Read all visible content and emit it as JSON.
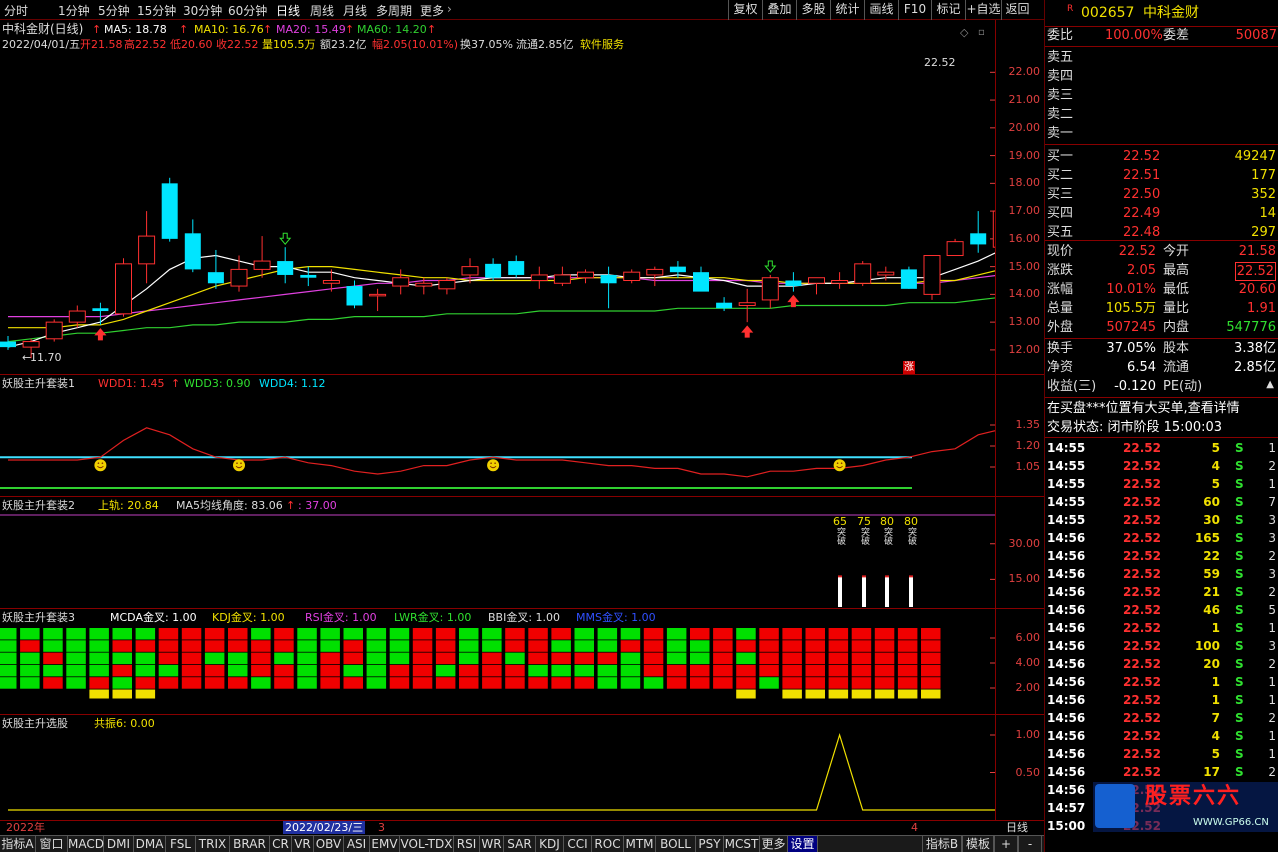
{
  "toolbar": {
    "periods": [
      "分时",
      "1分钟",
      "5分钟",
      "15分钟",
      "30分钟",
      "60分钟",
      "日线",
      "周线",
      "月线",
      "多周期",
      "更多"
    ],
    "active_period": "日线",
    "right_buttons": [
      "复权",
      "叠加",
      "多股",
      "统计",
      "画线",
      "F10",
      "标记",
      "+自选",
      "返回"
    ]
  },
  "main_panel": {
    "title": "中科金财(日线)",
    "ma5": "MA5: 18.78",
    "ma10": "MA10: 16.76",
    "ma20": "MA20: 15.49",
    "ma60": "MA60: 14.20",
    "bar_info": {
      "date": "2022/04/01/五",
      "open": "开21.58",
      "high": "高22.52",
      "low": "低20.60",
      "close": "收22.52",
      "vol": "量105.5万",
      "amount": "额23.2亿",
      "change": "幅2.05(10.01%)",
      "turnover": "换37.05%",
      "float": "流通2.85亿",
      "sector": "软件服务"
    },
    "y_ticks": [
      "22.00",
      "21.00",
      "20.00",
      "19.00",
      "18.00",
      "17.00",
      "16.00",
      "15.00",
      "14.00",
      "13.00",
      "12.00"
    ],
    "high_label": "22.52",
    "low_label": "11.70",
    "zhang_mark": "涨"
  },
  "chart_data": {
    "type": "candlestick",
    "ylim": [
      11.6,
      23.2
    ],
    "ohlc": [
      [
        12.3,
        12.5,
        12.0,
        12.1
      ],
      [
        12.1,
        12.4,
        11.7,
        12.3
      ],
      [
        12.4,
        13.1,
        12.3,
        13.0
      ],
      [
        13.0,
        13.6,
        12.8,
        13.4
      ],
      [
        13.5,
        13.7,
        12.9,
        13.4
      ],
      [
        13.3,
        15.3,
        13.2,
        15.1
      ],
      [
        15.1,
        17.0,
        14.4,
        16.1
      ],
      [
        18.0,
        18.2,
        15.9,
        16.0
      ],
      [
        16.2,
        16.7,
        14.8,
        14.9
      ],
      [
        14.8,
        15.6,
        14.2,
        14.4
      ],
      [
        14.3,
        15.4,
        14.1,
        14.9
      ],
      [
        14.9,
        16.1,
        14.6,
        15.2
      ],
      [
        15.2,
        15.7,
        14.4,
        14.7
      ],
      [
        14.7,
        15.0,
        14.3,
        14.6
      ],
      [
        14.4,
        14.9,
        14.1,
        14.5
      ],
      [
        14.3,
        14.5,
        13.5,
        13.6
      ],
      [
        14.0,
        14.2,
        13.4,
        14.0
      ],
      [
        14.3,
        14.9,
        14.0,
        14.6
      ],
      [
        14.3,
        14.6,
        14.0,
        14.4
      ],
      [
        14.2,
        14.6,
        14.0,
        14.5
      ],
      [
        14.7,
        15.3,
        14.4,
        15.0
      ],
      [
        15.1,
        15.3,
        14.5,
        14.6
      ],
      [
        15.2,
        15.4,
        14.6,
        14.7
      ],
      [
        14.5,
        15.0,
        14.2,
        14.7
      ],
      [
        14.4,
        15.0,
        14.3,
        14.7
      ],
      [
        14.6,
        14.9,
        14.4,
        14.8
      ],
      [
        14.7,
        15.0,
        13.5,
        14.4
      ],
      [
        14.5,
        14.9,
        14.4,
        14.8
      ],
      [
        14.7,
        15.0,
        14.3,
        14.9
      ],
      [
        15.0,
        15.2,
        14.6,
        14.8
      ],
      [
        14.8,
        15.0,
        14.2,
        14.1
      ],
      [
        13.7,
        13.9,
        13.4,
        13.5
      ],
      [
        13.6,
        14.2,
        13.0,
        13.7
      ],
      [
        13.8,
        14.7,
        13.5,
        14.6
      ],
      [
        14.5,
        14.8,
        14.1,
        14.3
      ],
      [
        14.4,
        14.6,
        14.0,
        14.6
      ],
      [
        14.4,
        14.8,
        14.2,
        14.5
      ],
      [
        14.4,
        15.2,
        14.3,
        15.1
      ],
      [
        14.7,
        15.0,
        14.5,
        14.8
      ],
      [
        14.9,
        15.0,
        14.2,
        14.2
      ],
      [
        14.0,
        15.4,
        13.8,
        15.4
      ],
      [
        15.4,
        16.0,
        15.4,
        15.9
      ],
      [
        16.2,
        17.0,
        15.5,
        15.8
      ],
      [
        15.7,
        17.2,
        15.5,
        17.0
      ],
      [
        16.8,
        18.7,
        16.6,
        18.5
      ],
      [
        18.8,
        21.0,
        18.6,
        20.5
      ],
      [
        20.7,
        22.52,
        20.6,
        22.52
      ]
    ],
    "ma5": [
      12.1,
      12.3,
      12.6,
      12.8,
      13.0,
      13.6,
      14.2,
      14.9,
      15.3,
      15.4,
      15.2,
      15.0,
      15.0,
      14.8,
      14.8,
      14.6,
      14.5,
      14.4,
      14.3,
      14.4,
      14.5,
      14.6,
      14.6,
      14.6,
      14.7,
      14.7,
      14.7,
      14.6,
      14.6,
      14.7,
      14.6,
      14.5,
      14.3,
      14.3,
      14.3,
      14.4,
      14.4,
      14.5,
      14.6,
      14.6,
      14.6,
      14.9,
      15.2,
      15.6,
      16.3,
      17.5,
      18.8
    ],
    "ma10": [
      12.8,
      12.8,
      12.8,
      12.9,
      12.9,
      13.1,
      13.4,
      13.7,
      14.0,
      14.3,
      14.5,
      14.7,
      14.9,
      15.0,
      15.0,
      14.9,
      14.8,
      14.7,
      14.6,
      14.6,
      14.5,
      14.5,
      14.5,
      14.5,
      14.5,
      14.6,
      14.6,
      14.6,
      14.6,
      14.6,
      14.6,
      14.6,
      14.5,
      14.5,
      14.4,
      14.4,
      14.4,
      14.4,
      14.4,
      14.4,
      14.5,
      14.5,
      14.7,
      14.9,
      15.3,
      15.9,
      16.8
    ],
    "ma20": [
      13.2,
      13.2,
      13.2,
      13.2,
      13.2,
      13.3,
      13.4,
      13.5,
      13.6,
      13.7,
      13.8,
      13.9,
      14.0,
      14.1,
      14.2,
      14.3,
      14.4,
      14.4,
      14.5,
      14.5,
      14.6,
      14.6,
      14.6,
      14.6,
      14.6,
      14.6,
      14.6,
      14.6,
      14.5,
      14.5,
      14.5,
      14.5,
      14.5,
      14.4,
      14.4,
      14.4,
      14.4,
      14.4,
      14.4,
      14.4,
      14.4,
      14.5,
      14.6,
      14.7,
      14.9,
      15.2,
      15.5
    ],
    "ma60": [
      12.3,
      12.4,
      12.5,
      12.6,
      12.6,
      12.7,
      12.8,
      12.8,
      12.9,
      12.9,
      13.0,
      13.0,
      13.0,
      13.1,
      13.1,
      13.2,
      13.2,
      13.2,
      13.2,
      13.3,
      13.3,
      13.3,
      13.3,
      13.4,
      13.4,
      13.4,
      13.4,
      13.4,
      13.4,
      13.5,
      13.5,
      13.5,
      13.5,
      13.5,
      13.6,
      13.6,
      13.6,
      13.6,
      13.6,
      13.7,
      13.7,
      13.7,
      13.8,
      13.9,
      14.0,
      14.1,
      14.2
    ],
    "wdd1": [
      1.1,
      1.1,
      1.1,
      1.1,
      1.12,
      1.24,
      1.33,
      1.28,
      1.18,
      1.12,
      1.1,
      1.1,
      1.12,
      1.08,
      1.06,
      1.02,
      1.0,
      1.02,
      1.06,
      1.06,
      1.1,
      1.12,
      1.1,
      1.1,
      1.1,
      1.08,
      1.06,
      1.06,
      1.04,
      1.04,
      1.0,
      1.0,
      0.98,
      1.02,
      1.02,
      1.04,
      1.04,
      1.06,
      1.1,
      1.12,
      1.16,
      1.18,
      1.28,
      1.32,
      1.38,
      1.48,
      1.55
    ],
    "wdd_ylim": [
      0.85,
      1.6
    ],
    "wdd3": 0.9,
    "wdd4": 1.12,
    "smile_idx": [
      4,
      10,
      21,
      36
    ],
    "rise_bars": [
      {
        "i": 36,
        "v": "65"
      },
      {
        "i": 37,
        "v": "75"
      },
      {
        "i": 38,
        "v": "80"
      },
      {
        "i": 39,
        "v": "80"
      }
    ],
    "signal_counts": [
      5,
      5,
      5,
      5,
      5,
      5,
      5,
      5,
      5,
      5,
      5,
      5,
      5,
      5,
      5,
      5,
      5,
      5,
      5,
      5,
      5,
      5,
      5,
      5,
      5,
      5,
      5,
      5,
      5,
      5,
      5,
      5,
      5,
      5,
      5,
      5,
      5,
      5,
      5,
      5,
      5,
      5,
      5,
      5,
      5,
      5,
      5
    ],
    "resonance": [
      0,
      0,
      0,
      0,
      0,
      0,
      0,
      0,
      0,
      0,
      0,
      0,
      0,
      0,
      0,
      0,
      0,
      0,
      0,
      0,
      0,
      0,
      0,
      0,
      0,
      0,
      0,
      0,
      0,
      0,
      0,
      0,
      0,
      0,
      0,
      0,
      1,
      0,
      0,
      0,
      0,
      0,
      0,
      0,
      0,
      0,
      0
    ]
  },
  "sub1": {
    "title": "妖股主升套装1",
    "wdd1": "WDD1: 1.45",
    "wdd3": "WDD3: 0.90",
    "wdd4": "WDD4: 1.12",
    "ticks": [
      "1.35",
      "1.20",
      "1.05"
    ]
  },
  "sub2": {
    "title": "妖股主升套装2",
    "track": "上轨: 20.84",
    "angle": "MA5均线角度: 83.06",
    "angle2": ": 37.00",
    "ticks": [
      "30.00",
      "15.00"
    ],
    "tag": "突破"
  },
  "sub3": {
    "title": "妖股主升套装3",
    "mcda": "MCDA金叉: 1.00",
    "kdj": "KDJ金叉: 1.00",
    "rsi": "RSI金叉: 1.00",
    "lwr": "LWR金叉: 1.00",
    "bbi": "BBI金叉: 1.00",
    "mms": "MMS金叉: 1.00",
    "ticks": [
      "6.00",
      "4.00",
      "2.00"
    ]
  },
  "sub4": {
    "title": "妖股主升选股",
    "gz": "共振6: 0.00",
    "ticks": [
      "1.00",
      "0.50"
    ]
  },
  "timeline": {
    "year": "2022年",
    "date": "2022/02/23/三",
    "marker3": "3",
    "marker4": "4",
    "period": "日线"
  },
  "bottom_tabs": [
    "指标A",
    "窗口",
    "MACD",
    "DMI",
    "DMA",
    "FSL",
    "TRIX",
    "BRAR",
    "CR",
    "VR",
    "OBV",
    "ASI",
    "EMV",
    "VOL-TDX",
    "RSI",
    "WR",
    "SAR",
    "KDJ",
    "CCI",
    "ROC",
    "MTM",
    "BOLL",
    "PSY",
    "MCST",
    "更多",
    "设置"
  ],
  "bottom_right": [
    "指标B",
    "模板",
    "+",
    "-"
  ],
  "colors": {
    "up": "#ff3030",
    "down": "#00e5ff",
    "ma5": "#ffffff",
    "ma10": "#f0e000",
    "ma20": "#e040e0",
    "ma60": "#30d030",
    "grid": "#800000"
  },
  "side": {
    "code": "002657",
    "name": "中科金财",
    "r_mark": "R",
    "weibi_label": "委比",
    "weibi": "100.00%",
    "weicha_label": "委差",
    "weicha": "50087",
    "sells": [
      "卖五",
      "卖四",
      "卖三",
      "卖二",
      "卖一"
    ],
    "buys": [
      {
        "l": "买一",
        "p": "22.52",
        "v": "49247"
      },
      {
        "l": "买二",
        "p": "22.51",
        "v": "177"
      },
      {
        "l": "买三",
        "p": "22.50",
        "v": "352"
      },
      {
        "l": "买四",
        "p": "22.49",
        "v": "14"
      },
      {
        "l": "买五",
        "p": "22.48",
        "v": "297"
      }
    ],
    "stats": [
      {
        "l1": "现价",
        "v1": "22.52",
        "c1": "#ff3030",
        "l2": "今开",
        "v2": "21.58",
        "c2": "#ff3030"
      },
      {
        "l1": "涨跌",
        "v1": "2.05",
        "c1": "#ff3030",
        "l2": "最高",
        "v2": "22.52",
        "c2": "#ff3030"
      },
      {
        "l1": "涨幅",
        "v1": "10.01%",
        "c1": "#ff3030",
        "l2": "最低",
        "v2": "20.60",
        "c2": "#ff3030"
      },
      {
        "l1": "总量",
        "v1": "105.5万",
        "c1": "#f0e000",
        "l2": "量比",
        "v2": "1.91",
        "c2": "#ff3030"
      },
      {
        "l1": "外盘",
        "v1": "507245",
        "c1": "#ff3030",
        "l2": "内盘",
        "v2": "547776",
        "c2": "#30e030"
      }
    ],
    "fin": [
      {
        "l1": "换手",
        "v1": "37.05%",
        "l2": "股本",
        "v2": "3.38亿"
      },
      {
        "l1": "净资",
        "v1": "6.54",
        "l2": "流通",
        "v2": "2.85亿"
      },
      {
        "l1": "收益(三)",
        "v1": "-0.120",
        "l2": "PE(动)",
        "v2": ""
      }
    ],
    "notice": "在买盘***位置有大买单,查看详情",
    "status": "交易状态: 闭市阶段 15:00:03",
    "ticks": [
      [
        "14:55",
        "22.52",
        "5",
        "S",
        "1"
      ],
      [
        "14:55",
        "22.52",
        "4",
        "S",
        "2"
      ],
      [
        "14:55",
        "22.52",
        "5",
        "S",
        "1"
      ],
      [
        "14:55",
        "22.52",
        "60",
        "S",
        "7"
      ],
      [
        "14:55",
        "22.52",
        "30",
        "S",
        "3"
      ],
      [
        "14:56",
        "22.52",
        "165",
        "S",
        "3"
      ],
      [
        "14:56",
        "22.52",
        "22",
        "S",
        "2"
      ],
      [
        "14:56",
        "22.52",
        "59",
        "S",
        "3"
      ],
      [
        "14:56",
        "22.52",
        "21",
        "S",
        "2"
      ],
      [
        "14:56",
        "22.52",
        "46",
        "S",
        "5"
      ],
      [
        "14:56",
        "22.52",
        "1",
        "S",
        "1"
      ],
      [
        "14:56",
        "22.52",
        "100",
        "S",
        "3"
      ],
      [
        "14:56",
        "22.52",
        "20",
        "S",
        "2"
      ],
      [
        "14:56",
        "22.52",
        "1",
        "S",
        "1"
      ],
      [
        "14:56",
        "22.52",
        "1",
        "S",
        "1"
      ],
      [
        "14:56",
        "22.52",
        "7",
        "S",
        "2"
      ],
      [
        "14:56",
        "22.52",
        "4",
        "S",
        "1"
      ],
      [
        "14:56",
        "22.52",
        "5",
        "S",
        "1"
      ],
      [
        "14:56",
        "22.52",
        "17",
        "S",
        "2"
      ],
      [
        "14:56",
        "22.52",
        "",
        "",
        ""
      ],
      [
        "14:57",
        "22.52",
        "",
        "",
        ""
      ],
      [
        "15:00",
        "22.52",
        "",
        "",
        ""
      ]
    ],
    "watermark": "股票六六",
    "watermark_url": "WWW.GP66.CN"
  }
}
